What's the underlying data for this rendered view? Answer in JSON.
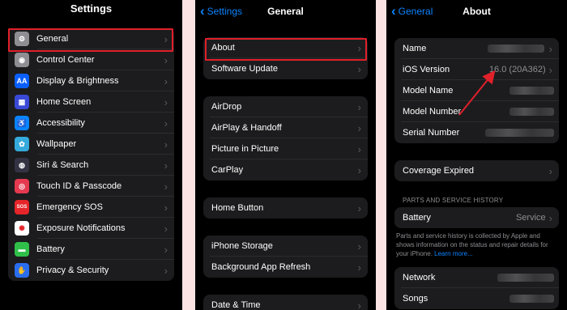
{
  "colors": {
    "accent": "#0a84ff",
    "highlight": "#e0202a",
    "background": "#000000",
    "group": "#1c1c1e"
  },
  "settings": {
    "title": "Settings",
    "items": [
      {
        "label": "General",
        "icon": "gear-icon",
        "color": "#8e8e93",
        "glyph": "⚙"
      },
      {
        "label": "Control Center",
        "icon": "control-center-icon",
        "color": "#8e8e93",
        "glyph": "◉"
      },
      {
        "label": "Display & Brightness",
        "icon": "display-brightness-icon",
        "color": "#0a60ff",
        "glyph": "AA"
      },
      {
        "label": "Home Screen",
        "icon": "home-screen-icon",
        "color": "#3a4ad6",
        "glyph": "▦"
      },
      {
        "label": "Accessibility",
        "icon": "accessibility-icon",
        "color": "#0a84ff",
        "glyph": "♿"
      },
      {
        "label": "Wallpaper",
        "icon": "wallpaper-icon",
        "color": "#35aadc",
        "glyph": "✿"
      },
      {
        "label": "Siri & Search",
        "icon": "siri-icon",
        "color": "#333344",
        "glyph": "◍"
      },
      {
        "label": "Touch ID & Passcode",
        "icon": "fingerprint-icon",
        "color": "#e5394f",
        "glyph": "◎"
      },
      {
        "label": "Emergency SOS",
        "icon": "sos-icon",
        "color": "#e5252a",
        "glyph": "SOS"
      },
      {
        "label": "Exposure Notifications",
        "icon": "exposure-notifications-icon",
        "color": "#ffffff",
        "glyph": "✺"
      },
      {
        "label": "Battery",
        "icon": "battery-icon",
        "color": "#30c04a",
        "glyph": "▬"
      },
      {
        "label": "Privacy & Security",
        "icon": "hand-icon",
        "color": "#2a6ef0",
        "glyph": "✋"
      }
    ]
  },
  "general": {
    "back": "Settings",
    "title": "General",
    "group1": [
      "About",
      "Software Update"
    ],
    "group2": [
      "AirDrop",
      "AirPlay & Handoff",
      "Picture in Picture",
      "CarPlay"
    ],
    "group3": [
      "Home Button"
    ],
    "group4": [
      "iPhone Storage",
      "Background App Refresh"
    ],
    "group5": [
      "Date & Time"
    ]
  },
  "about": {
    "back": "General",
    "title": "About",
    "info": {
      "name": "Name",
      "ios_version_label": "iOS Version",
      "ios_version_value": "16.0 (20A362)",
      "model_name": "Model Name",
      "model_number": "Model Number",
      "serial_number": "Serial Number"
    },
    "coverage": "Coverage Expired",
    "parts_header": "PARTS AND SERVICE HISTORY",
    "battery_label": "Battery",
    "battery_value": "Service",
    "footer_text": "Parts and service history is collected by Apple and shows information on the status and repair details for your iPhone.",
    "footer_link": "Learn more...",
    "network": "Network",
    "songs": "Songs"
  }
}
